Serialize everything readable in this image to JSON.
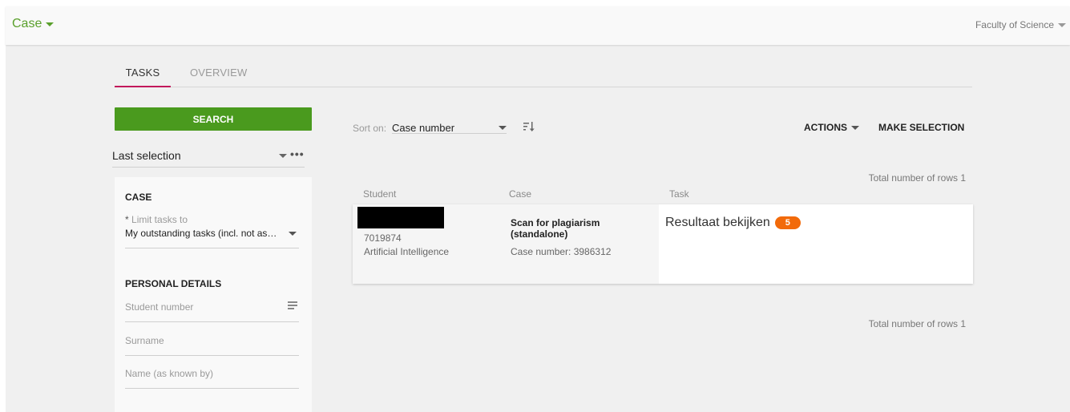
{
  "header": {
    "app_title": "Case",
    "faculty": "Faculty of Science"
  },
  "tabs": [
    {
      "label": "TASKS",
      "active": true
    },
    {
      "label": "OVERVIEW",
      "active": false
    }
  ],
  "sidebar": {
    "search_button": "SEARCH",
    "saved_selection": "Last selection",
    "case_section": {
      "title": "CASE",
      "limit_label": "Limit tasks to",
      "limit_required_mark": "*",
      "limit_value": "My outstanding tasks (incl. not assigned)"
    },
    "personal_section": {
      "title": "PERSONAL DETAILS",
      "student_number_placeholder": "Student number",
      "surname_placeholder": "Surname",
      "name_known_by_placeholder": "Name (as known by)"
    }
  },
  "toolbar": {
    "sort_label": "Sort on:",
    "sort_value": "Case number",
    "actions_label": "ACTIONS",
    "make_selection_label": "MAKE SELECTION"
  },
  "results": {
    "total_rows_label": "Total number of rows 1",
    "columns": [
      "Student",
      "Case",
      "Task"
    ],
    "rows": [
      {
        "student_number": "7019874",
        "programme": "Artificial Intelligence",
        "case_title": "Scan for plagiarism (standalone)",
        "case_number": "Case number: 3986312",
        "task": "Resultaat bekijken",
        "task_count": "5"
      }
    ]
  },
  "colors": {
    "brand_green": "#4a9a1e",
    "title_green": "#5aa02c",
    "tab_underline": "#c2185b",
    "badge_orange": "#f26a0a"
  }
}
